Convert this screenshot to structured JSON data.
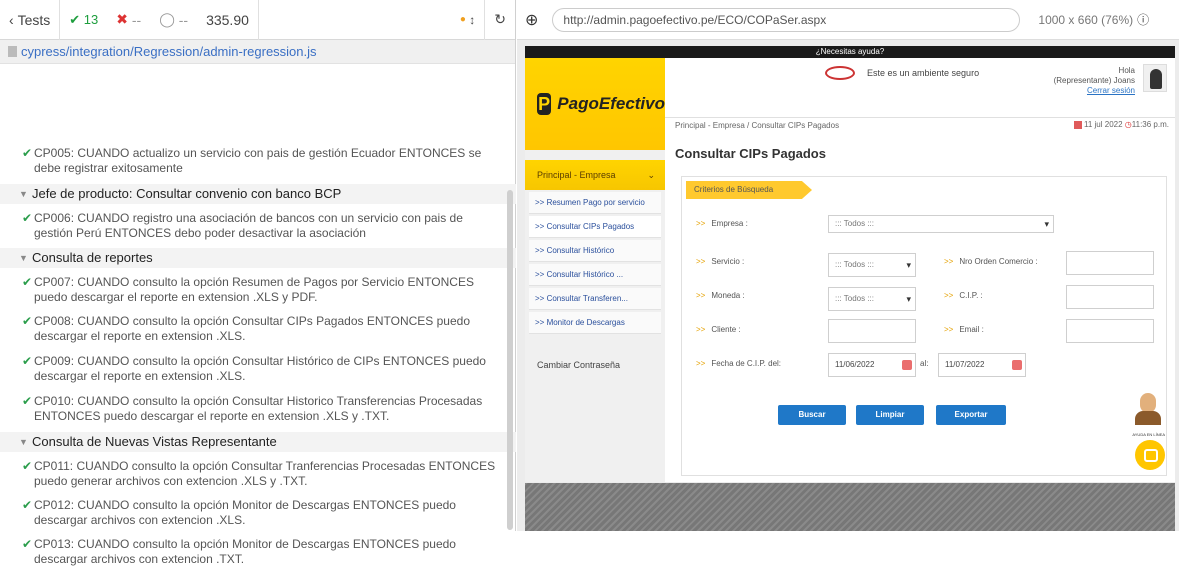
{
  "runner": {
    "tests_label": "Tests",
    "pass_count": "13",
    "fail_count": "--",
    "pending_count": "--",
    "duration": "335.90",
    "spec_path": "cypress/integration/Regression/admin-regression.js"
  },
  "tests": [
    {
      "kind": "test",
      "text": "CP005: CUANDO actualizo un servicio con pais de gestión Ecuador ENTONCES se debe registrar exitosamente"
    },
    {
      "kind": "suite",
      "text": "Jefe de producto: Consultar convenio con banco BCP"
    },
    {
      "kind": "test",
      "text": "CP006: CUANDO registro una asociación de bancos con un servicio con pais de gestión Perú ENTONCES debo poder desactivar la asociación"
    },
    {
      "kind": "suite",
      "text": "Consulta de reportes"
    },
    {
      "kind": "test",
      "text": "CP007: CUANDO consulto la opción Resumen de Pagos por Servicio ENTONCES puedo descargar el reporte en extension .XLS y PDF."
    },
    {
      "kind": "test",
      "text": "CP008: CUANDO consulto la opción Consultar CIPs Pagados ENTONCES puedo descargar el reporte en extension .XLS."
    },
    {
      "kind": "test",
      "text": "CP009: CUANDO consulto la opción Consultar Histórico de CIPs ENTONCES puedo descargar el reporte en extension .XLS."
    },
    {
      "kind": "test",
      "text": "CP010: CUANDO consulto la opción Consultar Historico Transferencias Procesadas ENTONCES puedo descargar el reporte en extension .XLS y .TXT."
    },
    {
      "kind": "suite",
      "text": "Consulta de Nuevas Vistas Representante"
    },
    {
      "kind": "test",
      "text": "CP011: CUANDO consulto la opción Consultar Tranferencias Procesadas ENTONCES puedo generar archivos con extencion .XLS y .TXT."
    },
    {
      "kind": "test",
      "text": "CP012: CUANDO consulto la opción Monitor de Descargas ENTONCES puedo descargar archivos con extencion .XLS."
    },
    {
      "kind": "test",
      "text": "CP013: CUANDO consulto la opción Monitor de Descargas ENTONCES puedo descargar archivos con extencion .TXT."
    }
  ],
  "browser": {
    "url": "http://admin.pagoefectivo.pe/ECO/COPaSer.aspx",
    "viewport": "1000 x 660 (76%)"
  },
  "app": {
    "help_text": "¿Necesitas ayuda?",
    "logo_text": "PagoEfectivo",
    "logo_mark": "P",
    "secure_text": "Este es un ambiente seguro",
    "hello": "Hola",
    "user_name": "(Representante) Joans",
    "logout": "Cerrar sesión",
    "breadcrumb": "Principal - Empresa / Consultar CIPs Pagados",
    "date": "11 jul 2022",
    "time": "11:36 p.m.",
    "page_title": "Consultar CIPs Pagados",
    "sidebar_header": "Principal - Empresa",
    "sidebar_items": [
      ">> Resumen Pago por servicio",
      ">> Consultar CIPs Pagados",
      ">> Consultar Histórico",
      ">> Consultar Histórico ...",
      ">> Consultar Transferen...",
      ">> Monitor de Descargas"
    ],
    "change_password": "Cambiar Contraseña",
    "criteria_tab": "Criterios de Búsqueda",
    "form": {
      "empresa_label": "Empresa :",
      "empresa_value": "::: Todos :::",
      "servicio_label": "Servicio :",
      "servicio_value": "::: Todos :::",
      "orden_label": "Nro Orden Comercio :",
      "moneda_label": "Moneda :",
      "moneda_value": "::: Todos :::",
      "cip_label": "C.I.P. :",
      "cliente_label": "Cliente :",
      "email_label": "Email :",
      "fecha_label": "Fecha de C.I.P. del:",
      "fecha_from": "11/06/2022",
      "al_label": "al:",
      "fecha_to": "11/07/2022"
    },
    "buttons": {
      "buscar": "Buscar",
      "limpiar": "Limpiar",
      "exportar": "Exportar"
    },
    "chat_label": "AYUDA EN LÍNEA"
  }
}
